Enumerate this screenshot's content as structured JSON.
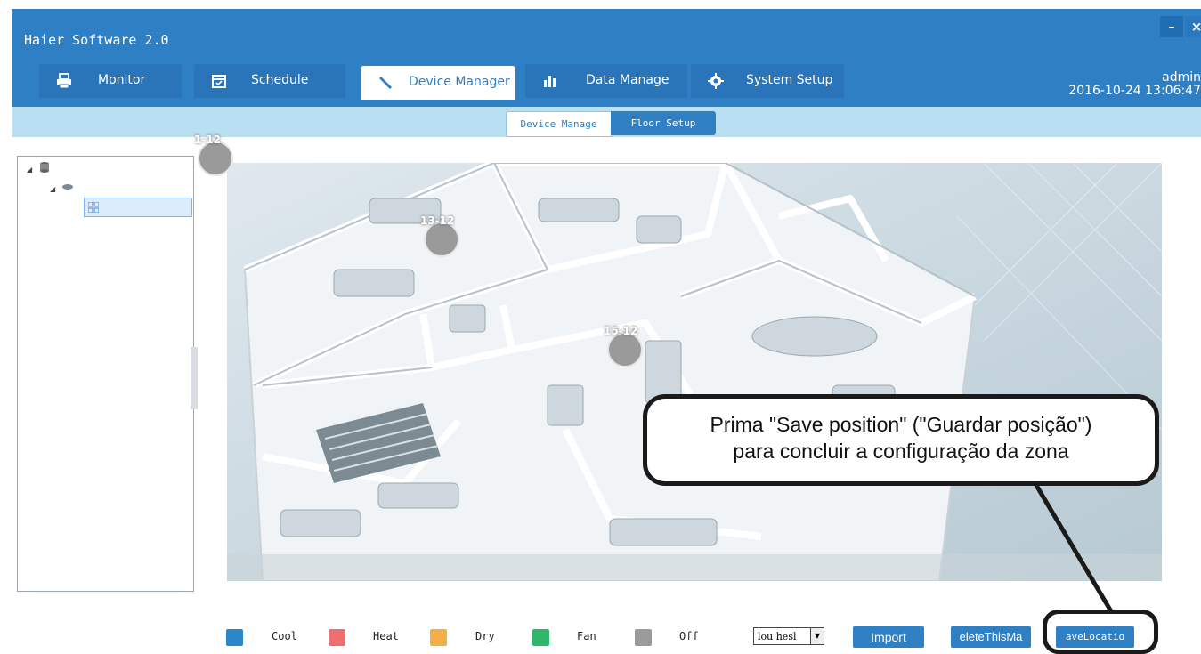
{
  "window": {
    "title": "Haier Software 2.0",
    "minimize_glyph": "–",
    "close_glyph": "×"
  },
  "tabs": [
    {
      "label": "Monitor",
      "icon": "printer-icon"
    },
    {
      "label": "Schedule",
      "icon": "calendar-icon"
    },
    {
      "label": "Device Manager",
      "icon": "wrench-icon",
      "active": true
    },
    {
      "label": "Data Manage",
      "icon": "bar-chart-icon"
    },
    {
      "label": "System Setup",
      "icon": "gear-icon"
    }
  ],
  "user": {
    "name": "admin",
    "datetime": "2016-10-24 13:06:47"
  },
  "subtabs": [
    "Device Manage",
    "Floor Setup"
  ],
  "markers": [
    "1-12",
    "13-12",
    "15-12"
  ],
  "callout": {
    "line1": "Prima \"Save position\" (\"Guardar posição\")",
    "line2": "para concluir a configuração da zona"
  },
  "legend": [
    {
      "label": "Cool",
      "color": "#2a87c9"
    },
    {
      "label": "Heat",
      "color": "#ee6f6f"
    },
    {
      "label": "Dry",
      "color": "#f5ad45"
    },
    {
      "label": "Fan",
      "color": "#2fb86a"
    },
    {
      "label": "Off",
      "color": "#9b9b9b"
    }
  ],
  "select": {
    "value": "lou hesl"
  },
  "buttons": {
    "import": "Import",
    "delete": "eleteThisMa",
    "save": "aveLocatio"
  }
}
